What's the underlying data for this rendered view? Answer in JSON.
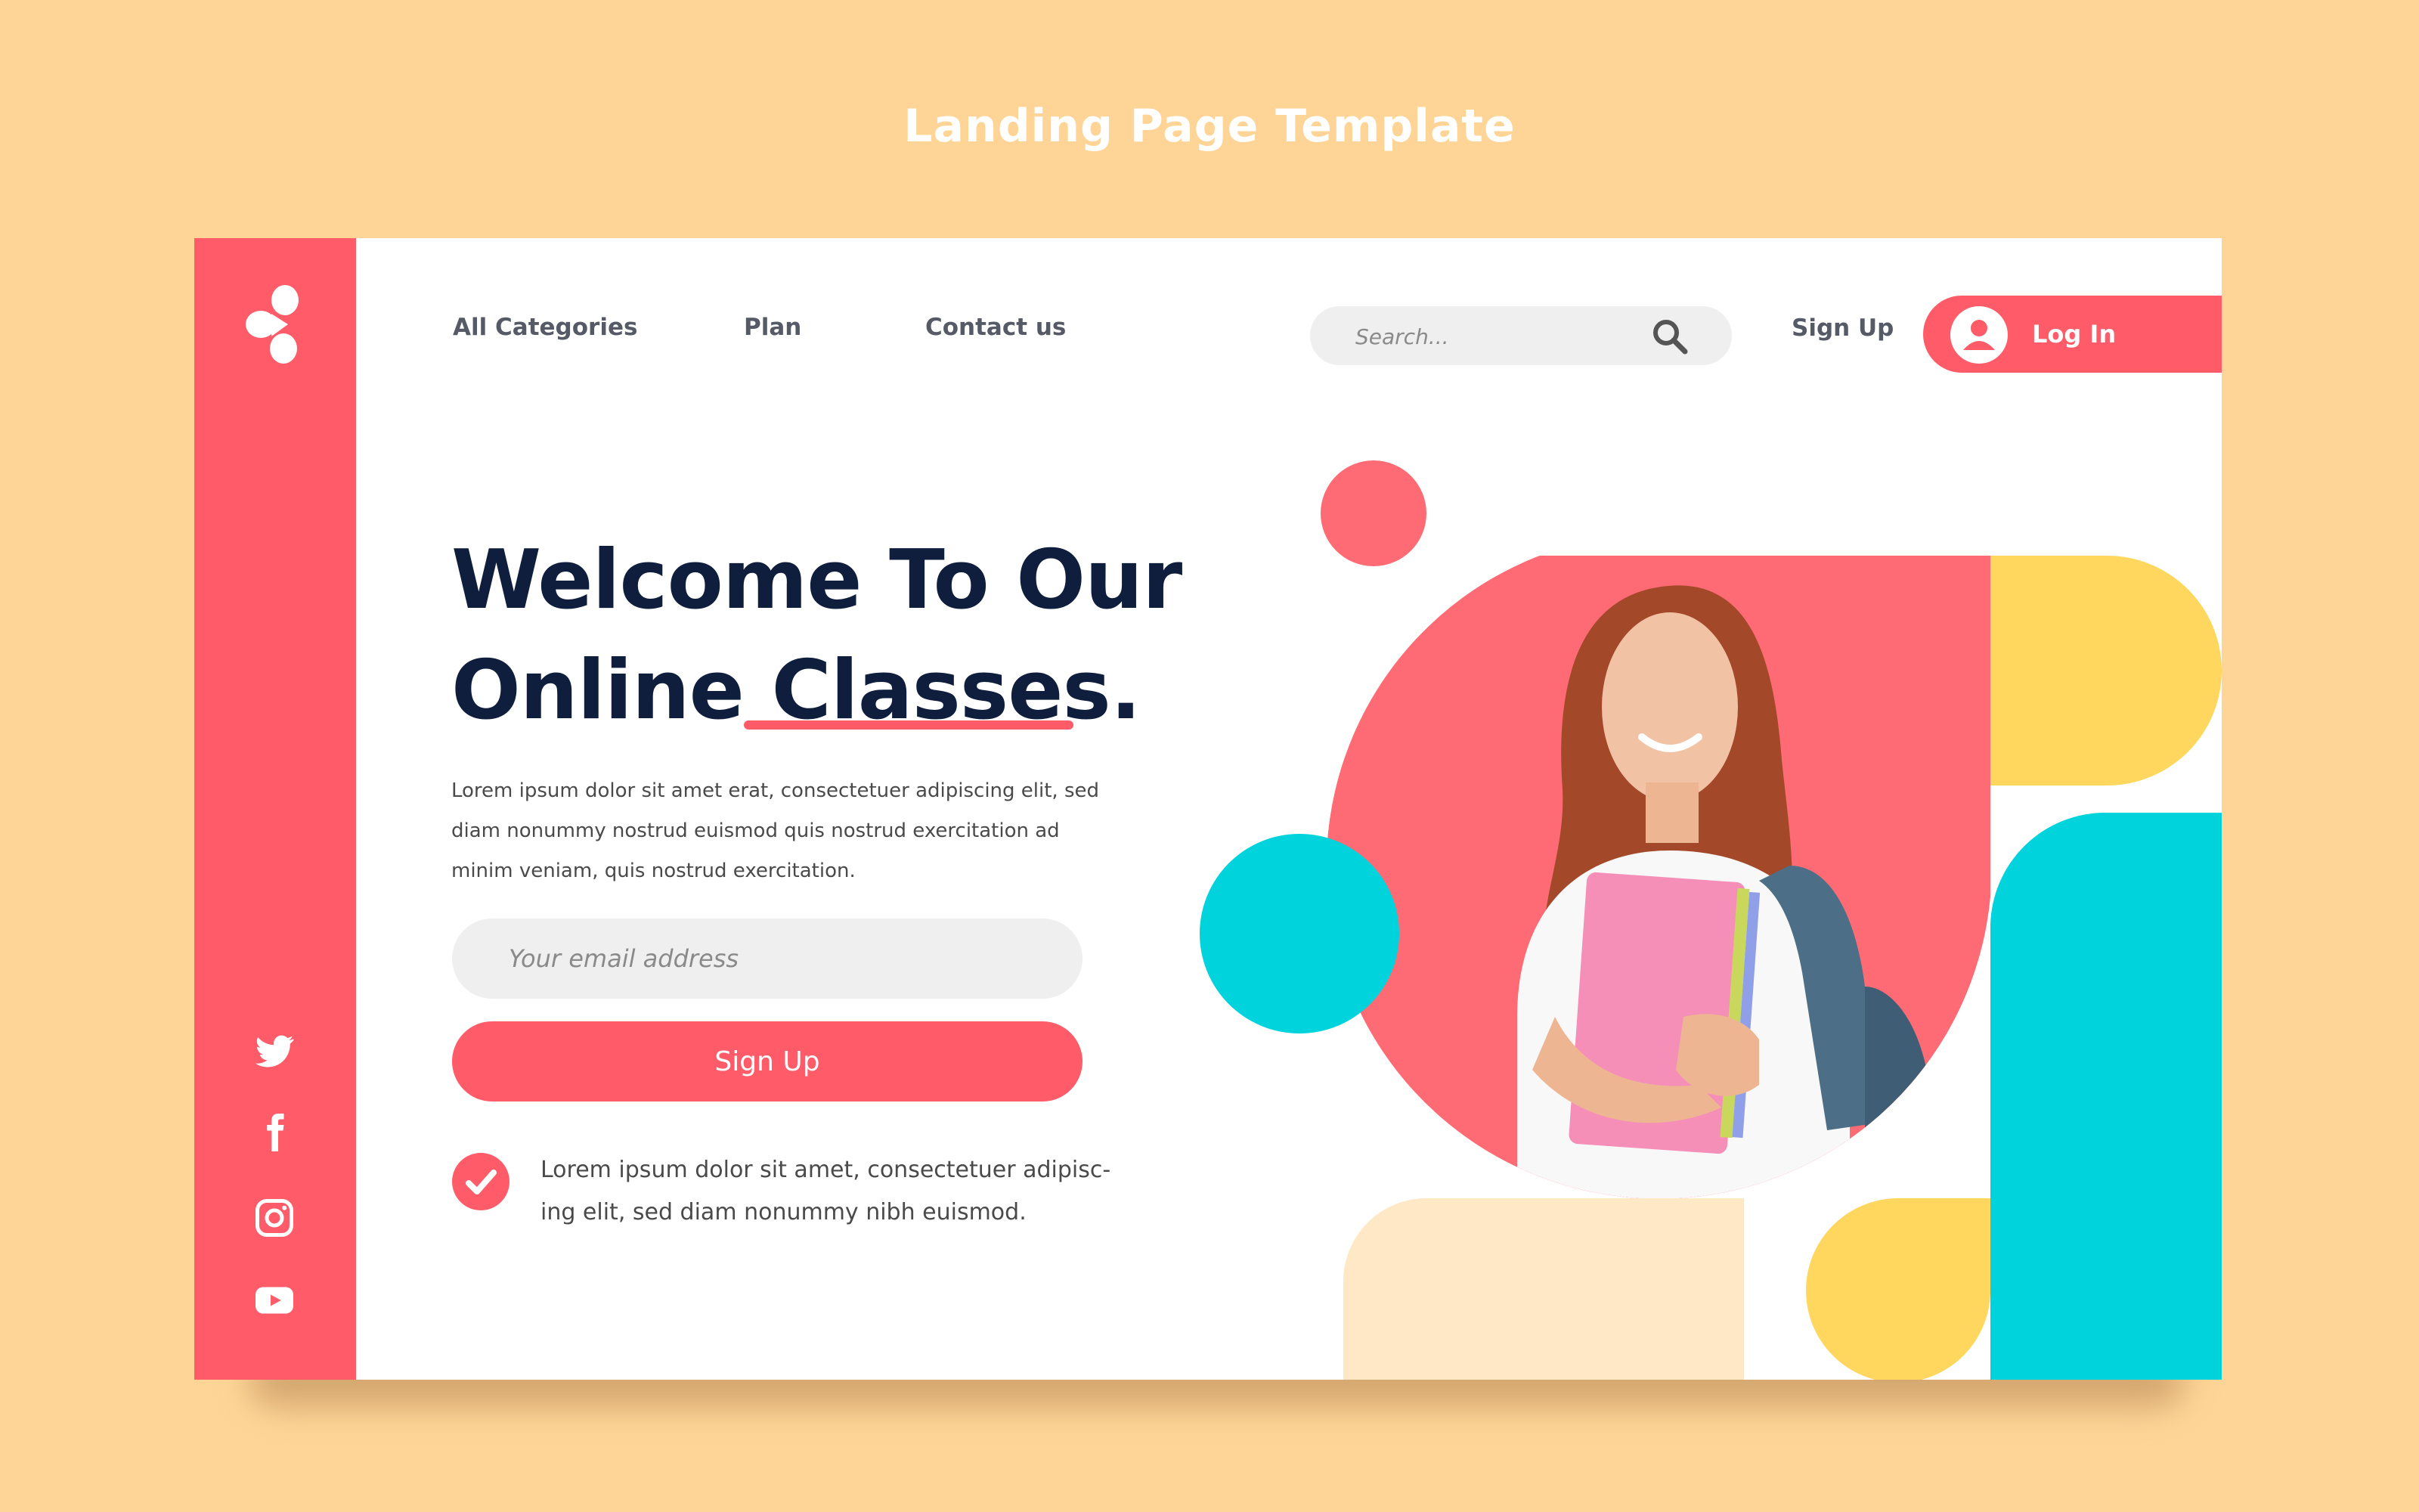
{
  "page_title": "Landing Page Template",
  "nav": {
    "all_categories": "All Categories",
    "plan": "Plan",
    "contact_us": "Contact us",
    "search_placeholder": "Search...",
    "sign_up": "Sign Up",
    "log_in": "Log In"
  },
  "hero": {
    "title_line1": "Welcome To Our",
    "title_line2": "Online Classes.",
    "description": "Lorem ipsum dolor sit amet erat, consectetuer adipiscing elit, sed diam nonummy nostrud euismod quis nostrud exercitation ad minim veniam, quis nostrud exercitation.",
    "email_placeholder": "Your email address",
    "signup_button": "Sign Up",
    "check_text": "Lorem ipsum dolor sit amet, consectetuer adipisc-ing elit, sed diam nonummy nibh euismod."
  },
  "social_icons": [
    "twitter-icon",
    "facebook-icon",
    "instagram-icon",
    "youtube-icon"
  ],
  "colors": {
    "background": "#FFD597",
    "accent": "#FF5B69",
    "navy": "#0F1E3C",
    "yellow": "#FFD75E",
    "cyan": "#00D3DC",
    "cream": "#FFE8C5"
  }
}
